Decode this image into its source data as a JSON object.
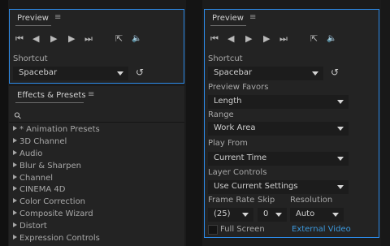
{
  "left": {
    "preview": {
      "title": "Preview",
      "menu_glyph": "≡",
      "transport_icons": [
        "first-frame-icon",
        "previous-frame-icon",
        "play-icon",
        "next-frame-icon",
        "last-frame-icon"
      ],
      "shortcut_label": "Shortcut",
      "shortcut_value": "Spacebar"
    },
    "effects": {
      "title": "Effects & Presets",
      "menu_glyph": "≡",
      "search_glyph": "⚲",
      "items": [
        "* Animation Presets",
        "3D Channel",
        "Audio",
        "Blur & Sharpen",
        "Channel",
        "CINEMA 4D",
        "Color Correction",
        "Composite Wizard",
        "Distort",
        "Expression Controls"
      ]
    }
  },
  "right": {
    "preview": {
      "title": "Preview",
      "menu_glyph": "≡",
      "shortcut_label": "Shortcut",
      "shortcut_value": "Spacebar",
      "preview_favors_label": "Preview Favors",
      "preview_favors_value": "Length",
      "range_label": "Range",
      "range_value": "Work Area",
      "play_from_label": "Play From",
      "play_from_value": "Current Time",
      "layer_controls_label": "Layer Controls",
      "layer_controls_value": "Use Current Settings",
      "frame_rate_label": "Frame Rate",
      "frame_rate_value": "(25)",
      "skip_label": "Skip",
      "skip_value": "0",
      "resolution_label": "Resolution",
      "resolution_value": "Auto",
      "full_screen_label": "Full Screen",
      "external_video_label": "External Video"
    }
  },
  "glyphs": {
    "first": "⏮",
    "prev": "◀",
    "play": "▶",
    "next": "▶",
    "last": "⏭",
    "loop": "⇱",
    "speaker": "🔈",
    "reset": "↺"
  },
  "colors": {
    "accent": "#2d8ceb",
    "link": "#3c98dc",
    "panel": "#232323",
    "field": "#1c1c1c"
  }
}
